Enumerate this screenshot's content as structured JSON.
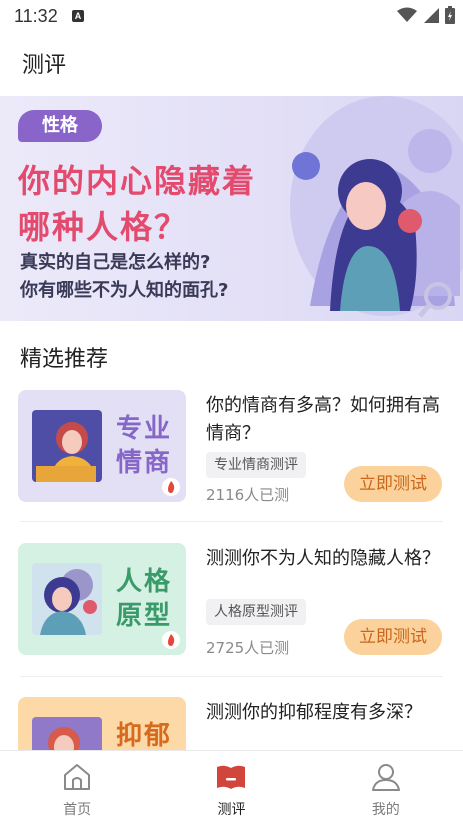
{
  "status_bar": {
    "time": "11:32",
    "notification_letter": "A"
  },
  "header": {
    "title": "测评"
  },
  "banner": {
    "tag": "性格",
    "headline_line1": "你的内心隐藏着",
    "headline_line2": "哪种人格？",
    "subtitle_line1": "真实的自己是怎么样的?",
    "subtitle_line2": "你有哪些不为人知的面孔?",
    "accent_color": "#e24a6e",
    "tag_color": "#8a65c9"
  },
  "section": {
    "title": "精选推荐"
  },
  "items": [
    {
      "thumb_label_line1": "专业",
      "thumb_label_line2": "情商",
      "title": "你的情商有多高？如何拥有高情商？",
      "chip": "专业情商测评",
      "count": "2116人已测",
      "button": "立即测试",
      "thumb_bg": "#e3e0f6",
      "label_color": "#8667c8"
    },
    {
      "thumb_label_line1": "人格",
      "thumb_label_line2": "原型",
      "title": "测测你不为人知的隐藏人格？",
      "chip": "人格原型测评",
      "count": "2725人已测",
      "button": "立即测试",
      "thumb_bg": "#d5f1e3",
      "label_color": "#3a9a6a"
    },
    {
      "thumb_label_line1": "抑郁",
      "thumb_label_line2": "",
      "title": "测测你的抑郁程度有多深？",
      "thumb_bg": "#fcd9a6",
      "label_color": "#d66a1e"
    }
  ],
  "tabbar": {
    "tabs": [
      {
        "label": "首页",
        "icon": "home-icon",
        "active": false
      },
      {
        "label": "测评",
        "icon": "assessment-icon",
        "active": true
      },
      {
        "label": "我的",
        "icon": "profile-icon",
        "active": false
      }
    ],
    "active_color": "#d2453b"
  }
}
